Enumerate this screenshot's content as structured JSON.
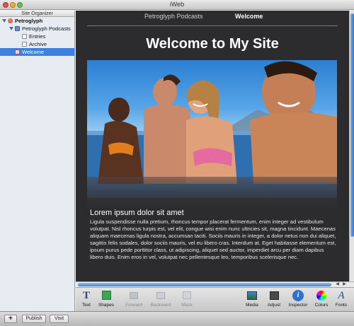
{
  "window": {
    "title": "iWeb"
  },
  "sidebar": {
    "header": "Site Organizer",
    "items": [
      {
        "label": "Petroglyph",
        "icon": "site-icon"
      },
      {
        "label": "Petroglyph Podcasts",
        "icon": "blog-icon"
      },
      {
        "label": "Entries",
        "icon": "entries-icon"
      },
      {
        "label": "Archive",
        "icon": "archive-icon"
      },
      {
        "label": "Welcome",
        "icon": "welcome-page-icon"
      }
    ]
  },
  "bottombar": {
    "add": "+",
    "publish": "Publish",
    "visit": "Visit"
  },
  "page": {
    "nav": [
      "Petroglyph Podcasts",
      "Welcome"
    ],
    "title": "Welcome to My Site",
    "body_title": "Lorem ipsum dolor sit amet",
    "body_text": "Ligula suspendisse nulla pretium, rhoncus tempor placerat fermentum, enim integer ad vestibulum volutpat. Nisl rhoncus turpis est, vel elit, congue wisi enim nunc ultricies sit, magna tincidunt. Maecenas aliquam maecenas ligula nostra, accumsan taciti. Sociis mauris in integer, a dolor netus non dui aliquet, sagittis felis sodales, dolor sociis mauris, vel eu libero cras. Interdum at. Eget habitasse elementum est, ipsum purus pede porttitor class, ut adipiscing, aliquet sed auctor, imperdiet arcu per diam dapibus libero duis. Enim eros in vel, volutpat nec pellentesque leo, temporibus scelerisque nec."
  },
  "toolbar": {
    "text": "Text",
    "shapes": "Shapes",
    "forward": "Forward",
    "backward": "Backward",
    "mask": "Mask",
    "media": "Media",
    "adjust": "Adjust",
    "inspector": "Inspector",
    "colors": "Colors",
    "fonts": "Fonts"
  },
  "colors": {
    "selection": "#3d80df",
    "canvas": "#2c2c2e",
    "accent": "#2f74cf"
  }
}
